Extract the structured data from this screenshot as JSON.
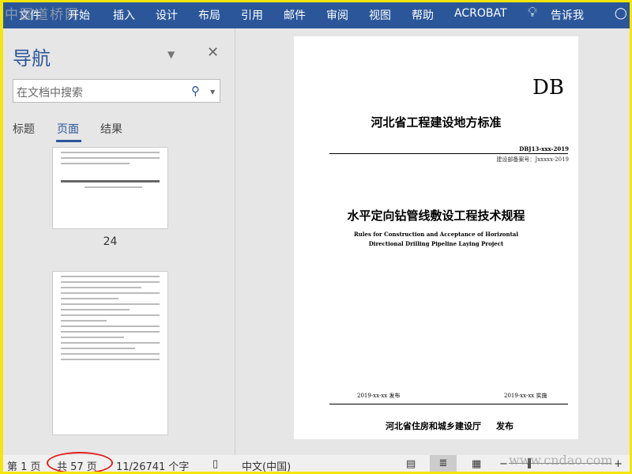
{
  "watermark": "中国道桥网",
  "ribbon": {
    "tabs": [
      "文件",
      "开始",
      "插入",
      "设计",
      "布局",
      "引用",
      "邮件",
      "审阅",
      "视图",
      "帮助",
      "ACROBAT"
    ],
    "tell_me": "告诉我"
  },
  "nav": {
    "title": "导航",
    "search_placeholder": "在文档中搜索",
    "tabs": [
      "标题",
      "页面",
      "结果"
    ],
    "active_tab": "页面",
    "thumb_label": "24"
  },
  "document": {
    "db": "DB",
    "org_title": "河北省工程建设地方标准",
    "code": "DBJ13-xxx-2019",
    "record": "建设部备案号：Jxxxxx-2019",
    "title": "水平定向钻管线敷设工程技术规程",
    "en_title_1": "Rules for Construction and Acceptance of Horizontal",
    "en_title_2": "Directional Drilling Pipeline Laying Project",
    "release_date": "2019-xx-xx 发布",
    "impl_date": "2019-xx-xx 实施",
    "publisher": "河北省住房和城乡建设厅",
    "publish": "发布"
  },
  "status": {
    "page": "第 1 页",
    "total": "共 57 页",
    "words": "11/26741 个字",
    "language": "中文(中国)",
    "site_watermark": "www.cndao.com"
  },
  "colors": {
    "ribbon": "#2b579a",
    "highlight_circle": "#e02020"
  }
}
